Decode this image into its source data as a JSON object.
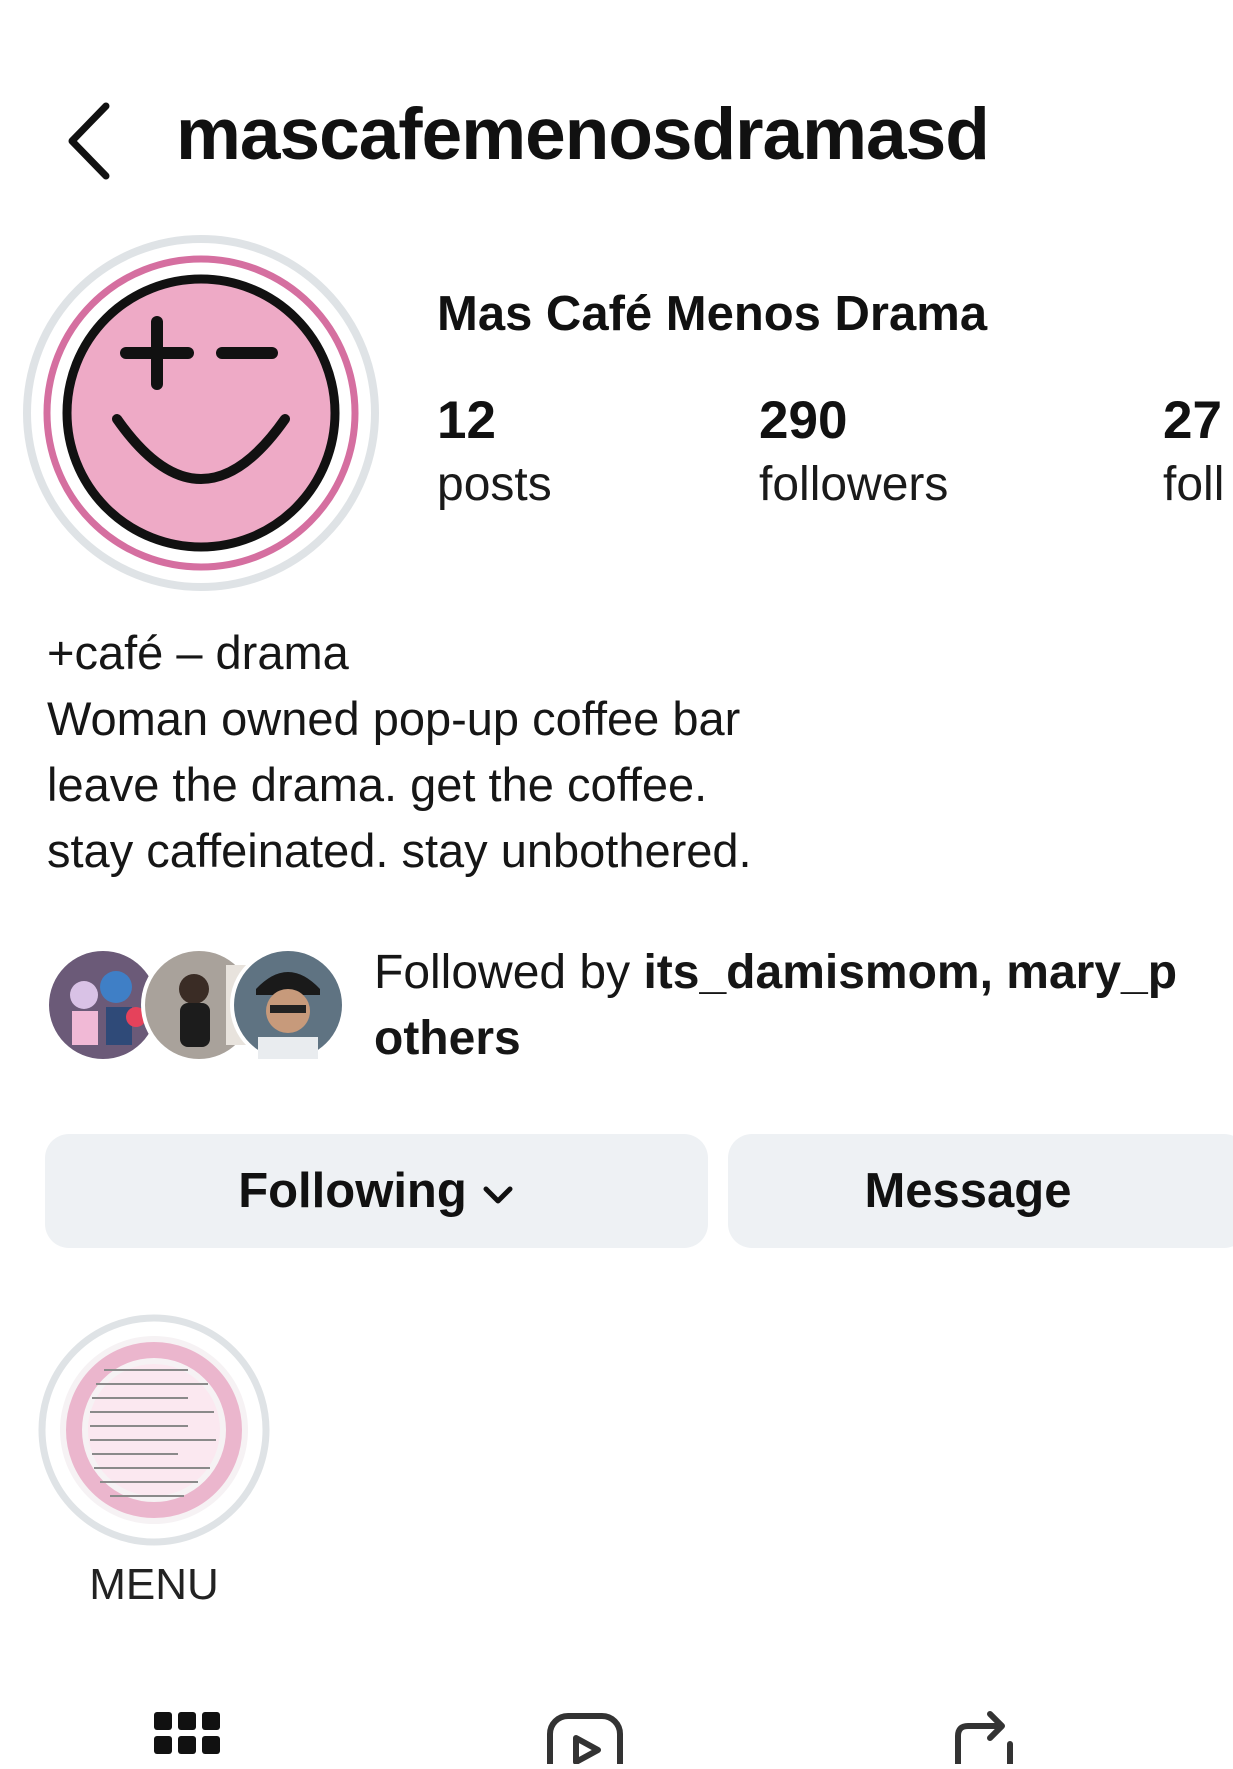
{
  "header": {
    "back_icon": "chevron-left-icon",
    "username": "mascafemenosdramasd"
  },
  "profile": {
    "display_name": "Mas Café Menos Drama",
    "avatar_icon": "plus-minus-smiley-logo",
    "stats": [
      {
        "value": "12",
        "label": "posts"
      },
      {
        "value": "290",
        "label": "followers"
      },
      {
        "value": "27",
        "label": "foll"
      }
    ]
  },
  "bio": {
    "lines": [
      "+café – drama",
      "Woman owned pop-up coffee bar",
      "leave the drama. get the coffee.",
      "stay caffeinated. stay unbothered."
    ]
  },
  "mutuals": {
    "prefix": "Followed by ",
    "names": "its_damismom, mary_p",
    "suffix": "others"
  },
  "actions": {
    "following_label": "Following",
    "message_label": "Message"
  },
  "highlights": [
    {
      "label": "MENU"
    }
  ],
  "tabs": [
    {
      "icon": "grid-icon"
    },
    {
      "icon": "reels-icon"
    },
    {
      "icon": "reposts-icon"
    }
  ],
  "colors": {
    "accent_pink": "#eeaac6",
    "ring_pink": "#d56fa0",
    "ring_gray": "#dfe3e6",
    "button_bg": "#eef1f4"
  }
}
